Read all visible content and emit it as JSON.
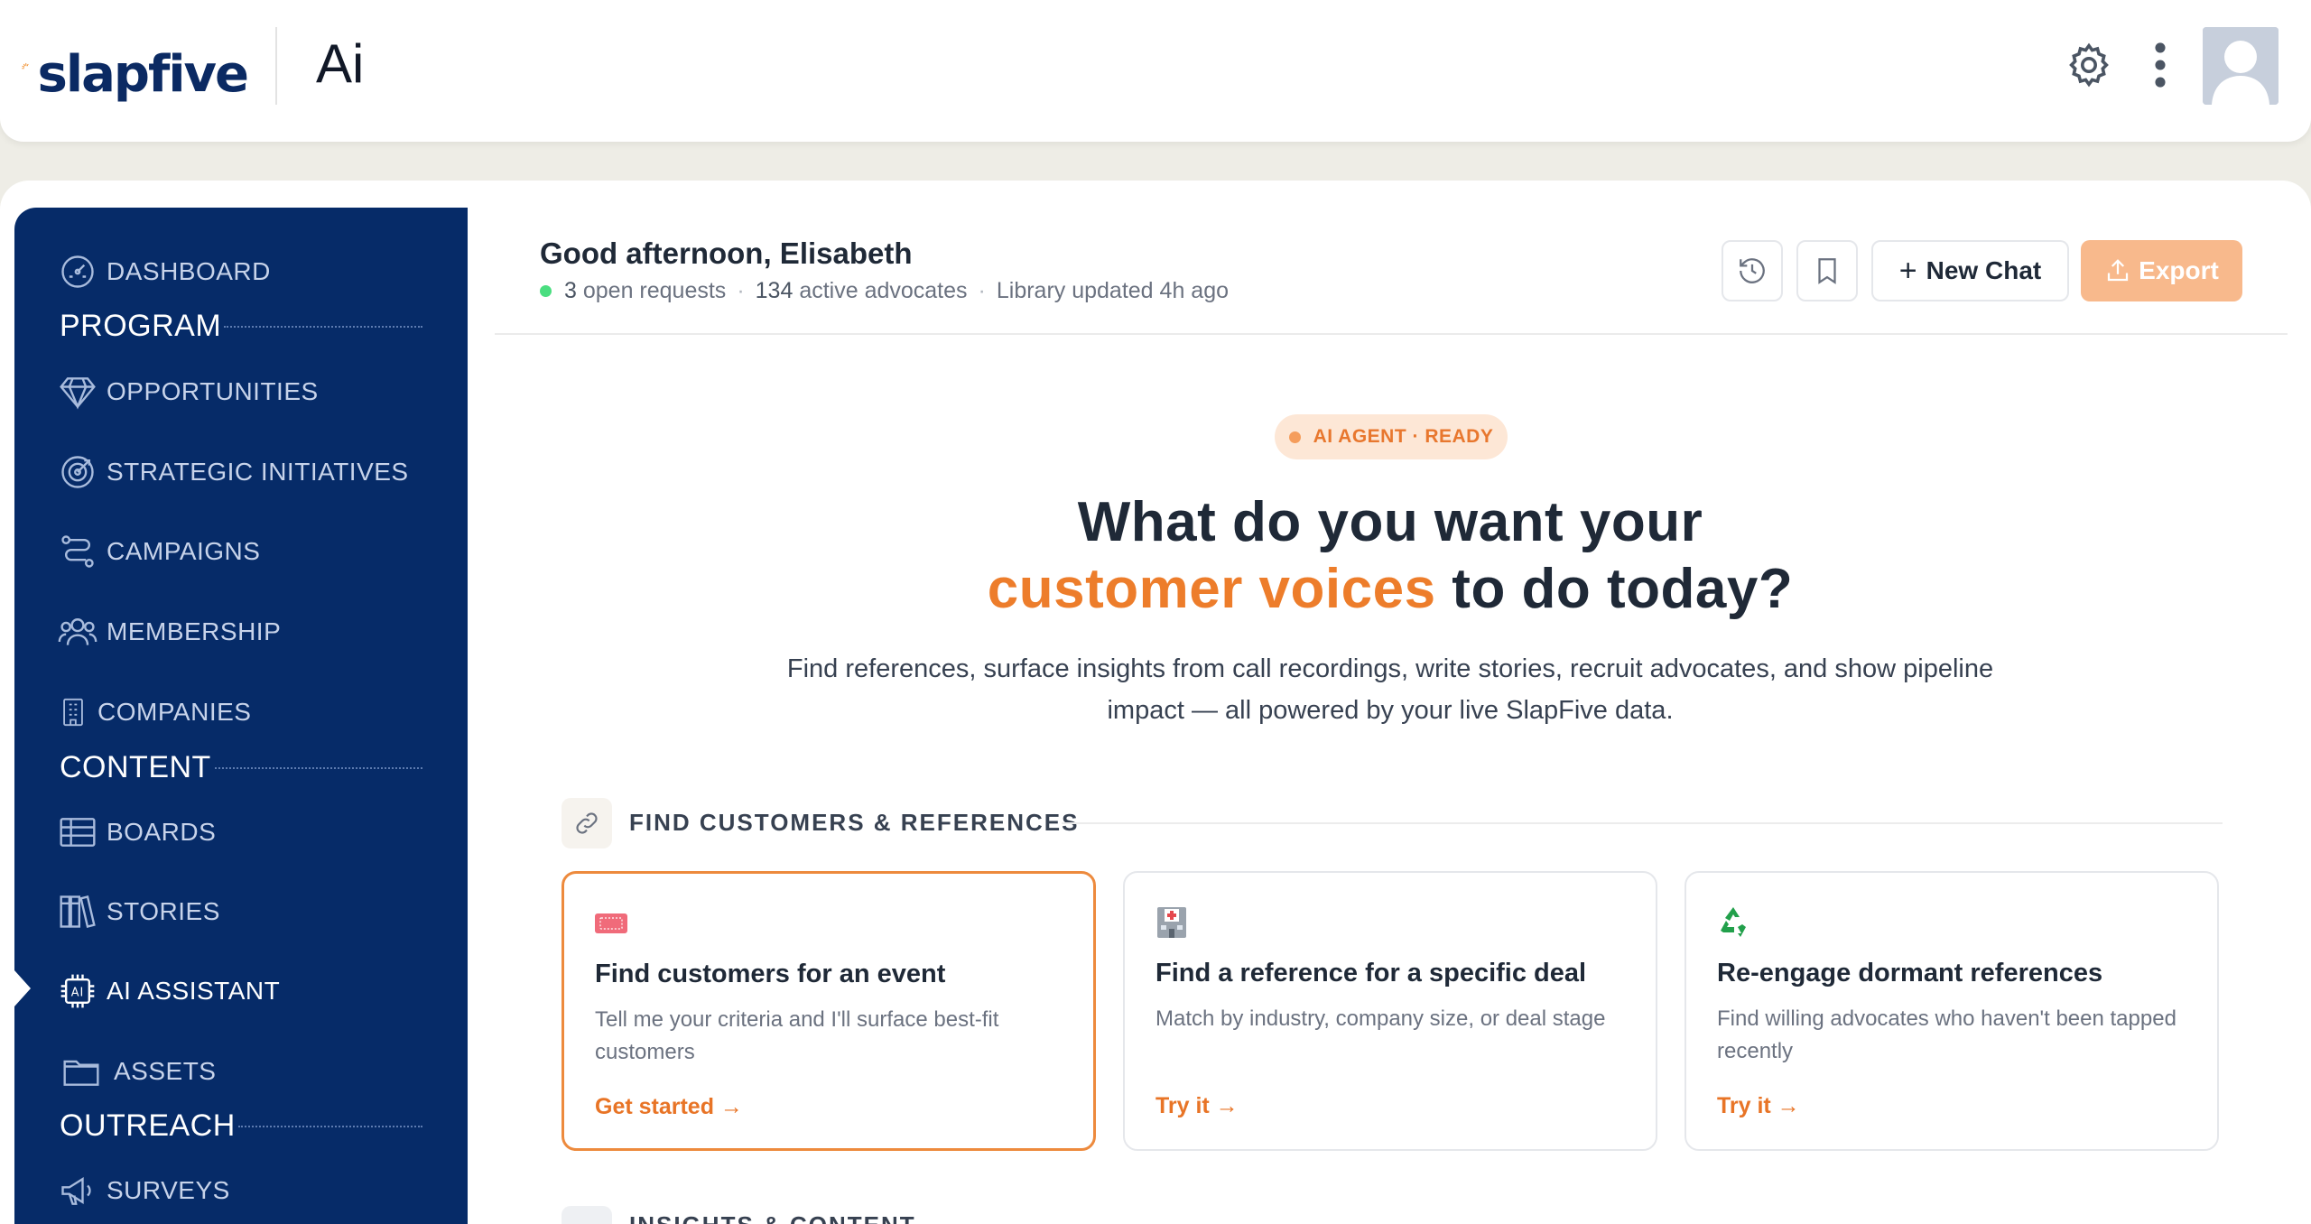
{
  "header": {
    "logo_text": "slapfive",
    "app_title": "Ai"
  },
  "sidebar": {
    "items": [
      {
        "label": "DASHBOARD",
        "icon": "dashboard-icon"
      },
      {
        "label": "OPPORTUNITIES",
        "icon": "diamond-icon"
      },
      {
        "label": "STRATEGIC INITIATIVES",
        "icon": "target-icon"
      },
      {
        "label": "CAMPAIGNS",
        "icon": "route-icon"
      },
      {
        "label": "MEMBERSHIP",
        "icon": "users-icon"
      },
      {
        "label": "COMPANIES",
        "icon": "building-icon"
      },
      {
        "label": "BOARDS",
        "icon": "table-icon"
      },
      {
        "label": "STORIES",
        "icon": "books-icon"
      },
      {
        "label": "AI ASSISTANT",
        "icon": "ai-chip-icon"
      },
      {
        "label": "ASSETS",
        "icon": "folder-icon"
      },
      {
        "label": "SURVEYS",
        "icon": "megaphone-icon"
      }
    ],
    "sections": [
      "PROGRAM",
      "CONTENT",
      "OUTREACH"
    ],
    "active": "AI ASSISTANT"
  },
  "content_header": {
    "greeting": "Good afternoon, Elisabeth",
    "open_requests": "3",
    "open_requests_label": "open requests",
    "advocates": "134",
    "advocates_label": "active advocates",
    "library": "Library updated 4h ago",
    "new_chat_label": "New Chat",
    "export_label": "Export"
  },
  "hero": {
    "badge": "AI AGENT · READY",
    "title_line1": "What do you want your",
    "title_accent": "customer voices",
    "title_rest": " to do today?",
    "subtitle": "Find references, surface insights from call recordings, write stories, recruit advocates, and show pipeline impact — all powered by your live SlapFive data."
  },
  "section_find": {
    "title": "FIND CUSTOMERS & REFERENCES",
    "cards": [
      {
        "title": "Find customers for an event",
        "desc": "Tell me your criteria and I'll surface best-fit customers",
        "cta": "Get started →",
        "icon": "ticket-icon"
      },
      {
        "title": "Find a reference for a specific deal",
        "desc": "Match by industry, company size, or deal stage",
        "cta": "Try it →",
        "icon": "hospital-icon"
      },
      {
        "title": "Re-engage dormant references",
        "desc": "Find willing advocates who haven't been tapped recently",
        "cta": "Try it →",
        "icon": "recycle-icon"
      }
    ]
  },
  "section_insights": {
    "title": "INSIGHTS & CONTENT"
  },
  "colors": {
    "sidebar": "#062b68",
    "accent": "#ed7d2b",
    "export_button": "#f8b98c"
  }
}
